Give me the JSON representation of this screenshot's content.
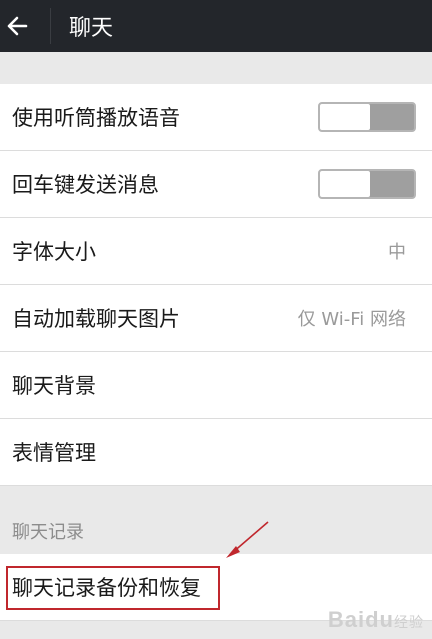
{
  "header": {
    "title": "聊天"
  },
  "settings": [
    {
      "label": "使用听筒播放语音",
      "control": "toggle",
      "on": false
    },
    {
      "label": "回车键发送消息",
      "control": "toggle",
      "on": false
    },
    {
      "label": "字体大小",
      "value": "中"
    },
    {
      "label": "自动加载聊天图片",
      "value": "仅 Wi-Fi 网络"
    },
    {
      "label": "聊天背景"
    },
    {
      "label": "表情管理"
    }
  ],
  "section": {
    "title": "聊天记录",
    "items": [
      {
        "label": "聊天记录备份和恢复"
      }
    ]
  },
  "annotation": {
    "color": "#c0272d"
  },
  "watermark": {
    "text": "Baidu",
    "sub": "经验"
  }
}
